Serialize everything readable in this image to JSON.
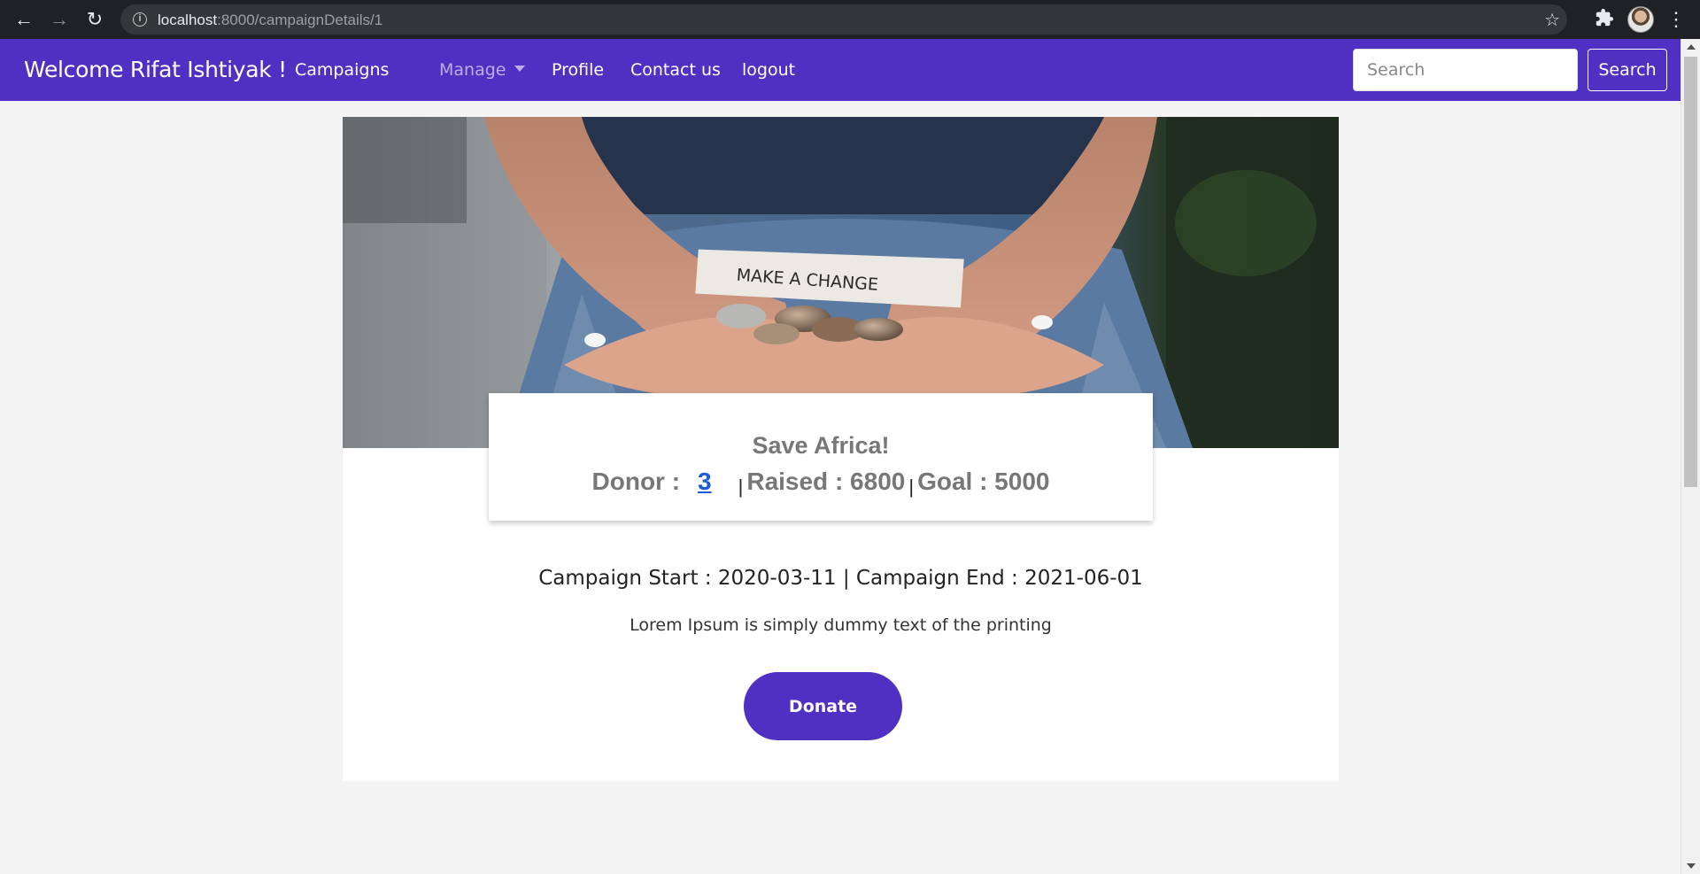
{
  "browser": {
    "url_host": "localhost",
    "url_path": ":8000/campaignDetails/1"
  },
  "navbar": {
    "brand": "Welcome Rifat Ishtiyak !",
    "links": {
      "campaigns": "Campaigns",
      "manage": "Manage",
      "profile": "Profile",
      "contact": "Contact us",
      "logout": "logout"
    },
    "search_placeholder": "Search",
    "search_button": "Search",
    "colors": {
      "navbar_bg": "#4f30c2"
    }
  },
  "campaign": {
    "hero_image_caption": "MAKE A CHANGE",
    "title": "Save Africa!",
    "donor_label": "Donor :",
    "donor_count": "3",
    "separator": "|",
    "raised": "Raised : 6800",
    "goal": "Goal : 5000",
    "dates": "Campaign Start : 2020-03-11 | Campaign End : 2021-06-01",
    "description": "Lorem Ipsum is simply dummy text of the printing",
    "donate_button": "Donate"
  }
}
